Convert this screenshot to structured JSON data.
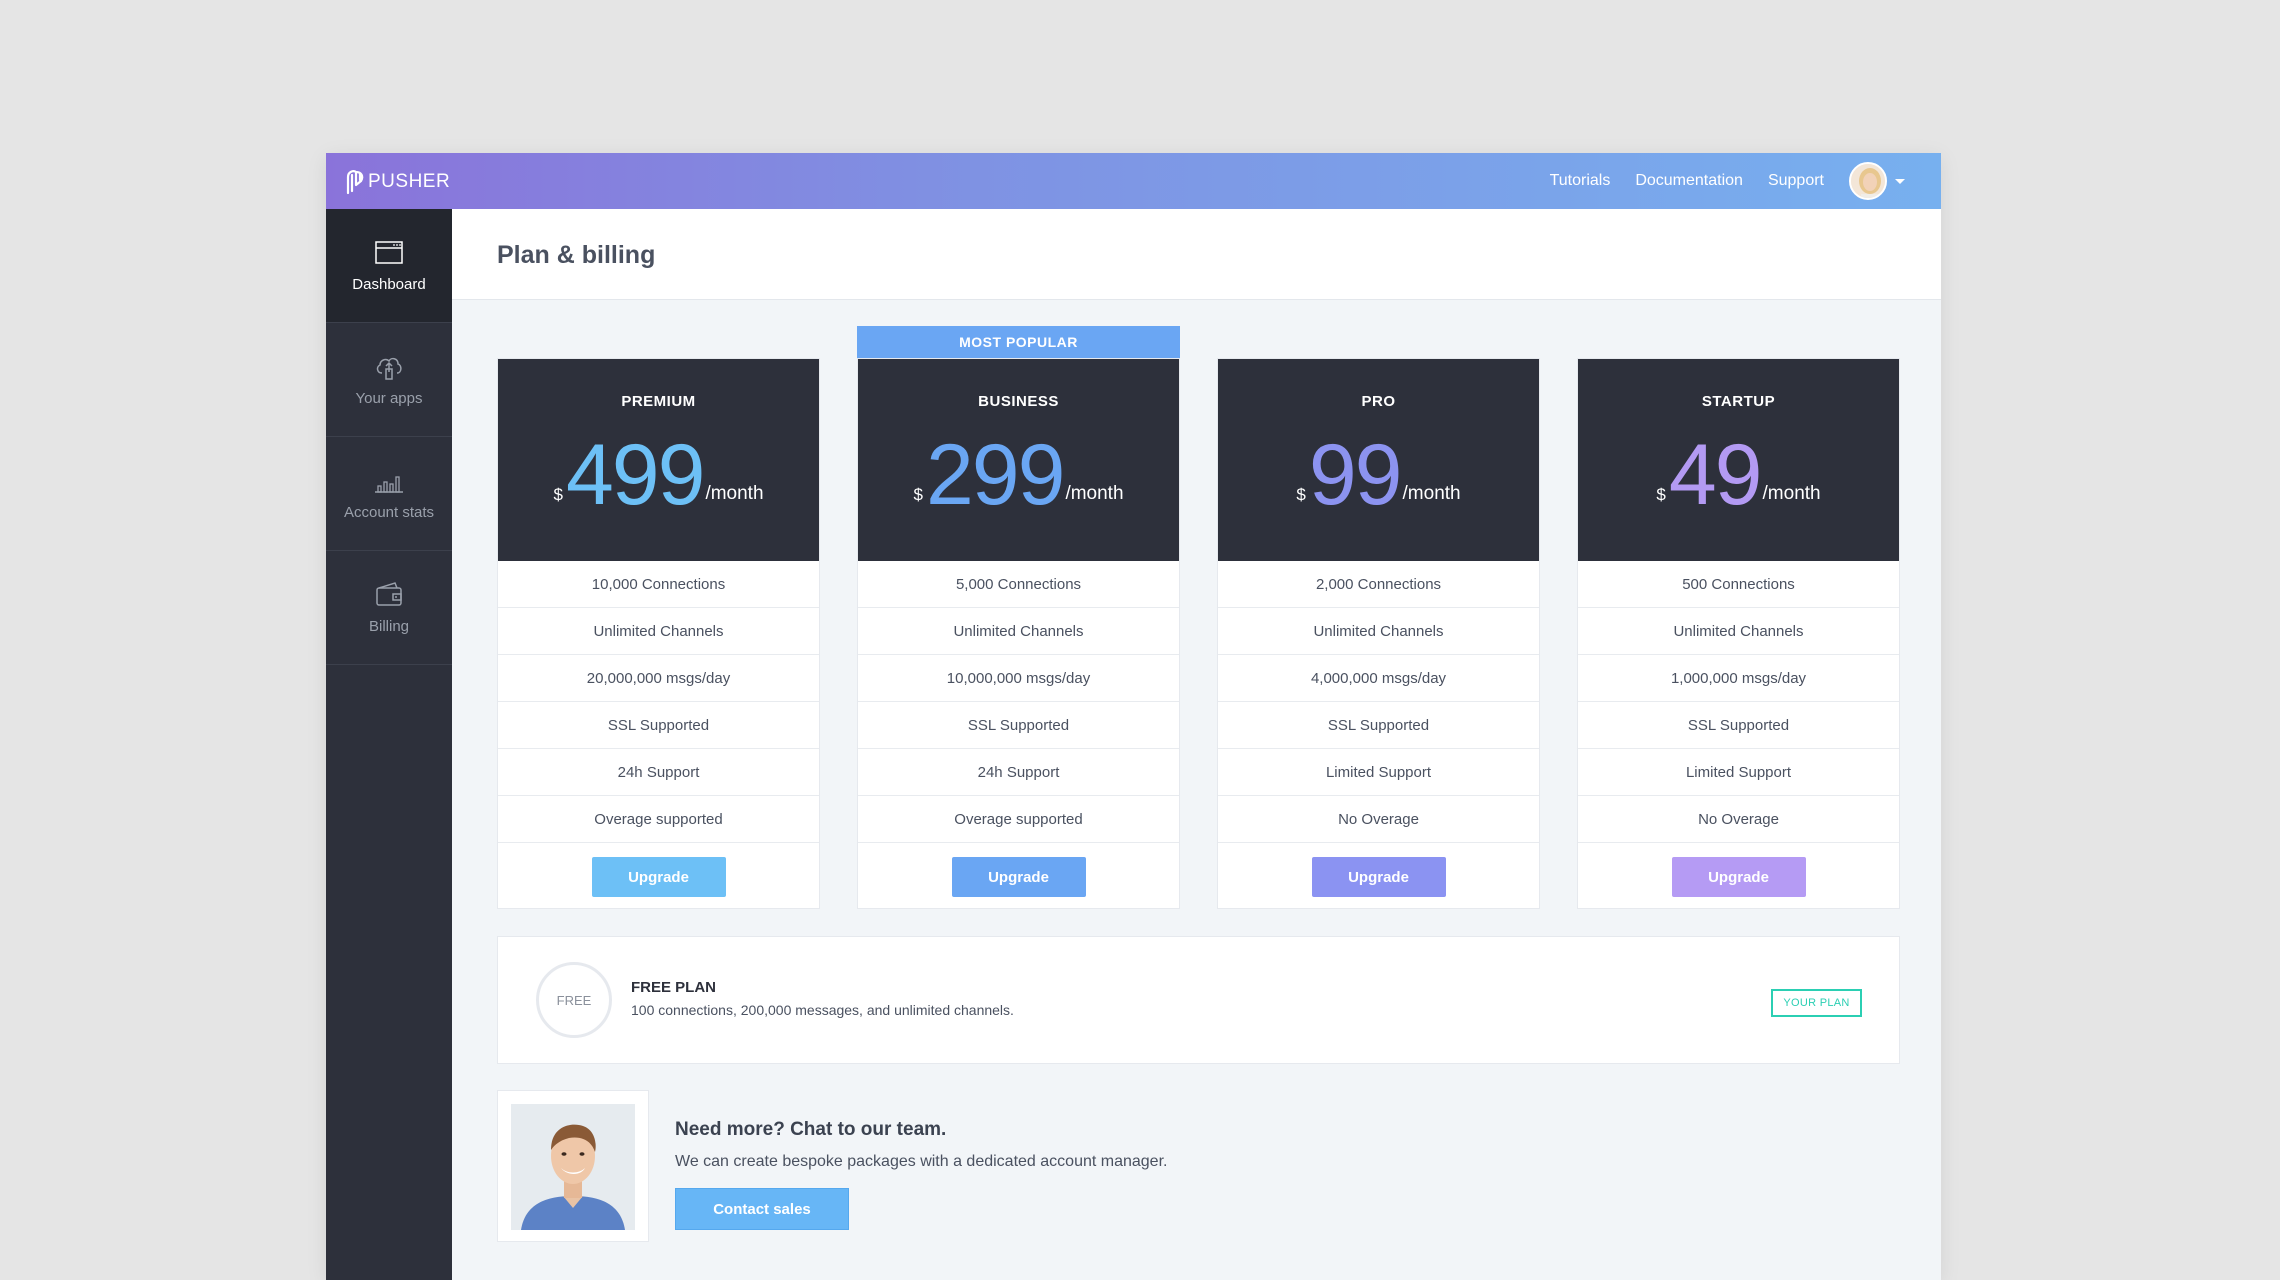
{
  "brand": {
    "name": "PUSHER"
  },
  "topnav": {
    "links": [
      "Tutorials",
      "Documentation",
      "Support"
    ]
  },
  "sidebar": {
    "items": [
      {
        "label": "Dashboard",
        "icon": "window-icon",
        "active": true
      },
      {
        "label": "Your apps",
        "icon": "cloud-upload-icon",
        "active": false
      },
      {
        "label": "Account stats",
        "icon": "bar-chart-icon",
        "active": false
      },
      {
        "label": "Billing",
        "icon": "wallet-icon",
        "active": false
      }
    ]
  },
  "page": {
    "title": "Plan & billing"
  },
  "ribbon": {
    "label": "MOST POPULAR"
  },
  "plans": [
    {
      "name": "PREMIUM",
      "currency": "$",
      "amount": "499",
      "period": "/month",
      "color": "#6dc0f6",
      "features": [
        "10,000 Connections",
        "Unlimited Channels",
        "20,000,000 msgs/day",
        "SSL Supported",
        "24h Support",
        "Overage supported"
      ],
      "button": "Upgrade",
      "button_color": "#6dc0f6"
    },
    {
      "name": "BUSINESS",
      "currency": "$",
      "amount": "299",
      "period": "/month",
      "color": "#6aa6f3",
      "features": [
        "5,000 Connections",
        "Unlimited Channels",
        "10,000,000 msgs/day",
        "SSL Supported",
        "24h Support",
        "Overage supported"
      ],
      "button": "Upgrade",
      "button_color": "#6aa6f3"
    },
    {
      "name": "PRO",
      "currency": "$",
      "amount": "99",
      "period": "/month",
      "color": "#8c93f0",
      "features": [
        "2,000 Connections",
        "Unlimited Channels",
        "4,000,000 msgs/day",
        "SSL Supported",
        "Limited Support",
        "No Overage"
      ],
      "button": "Upgrade",
      "button_color": "#8b93f2"
    },
    {
      "name": "STARTUP",
      "currency": "$",
      "amount": "49",
      "period": "/month",
      "color": "#b39af3",
      "features": [
        "500 Connections",
        "Unlimited Channels",
        "1,000,000 msgs/day",
        "SSL Supported",
        "Limited Support",
        "No Overage"
      ],
      "button": "Upgrade",
      "button_color": "#b59bf4"
    }
  ],
  "free_plan": {
    "badge": "FREE",
    "title": "FREE PLAN",
    "description": "100 connections, 200,000 messages, and unlimited channels.",
    "status": "YOUR PLAN"
  },
  "contact": {
    "title": "Need more? Chat to our team.",
    "description": "We can create bespoke packages with a dedicated account manager.",
    "button": "Contact sales"
  }
}
